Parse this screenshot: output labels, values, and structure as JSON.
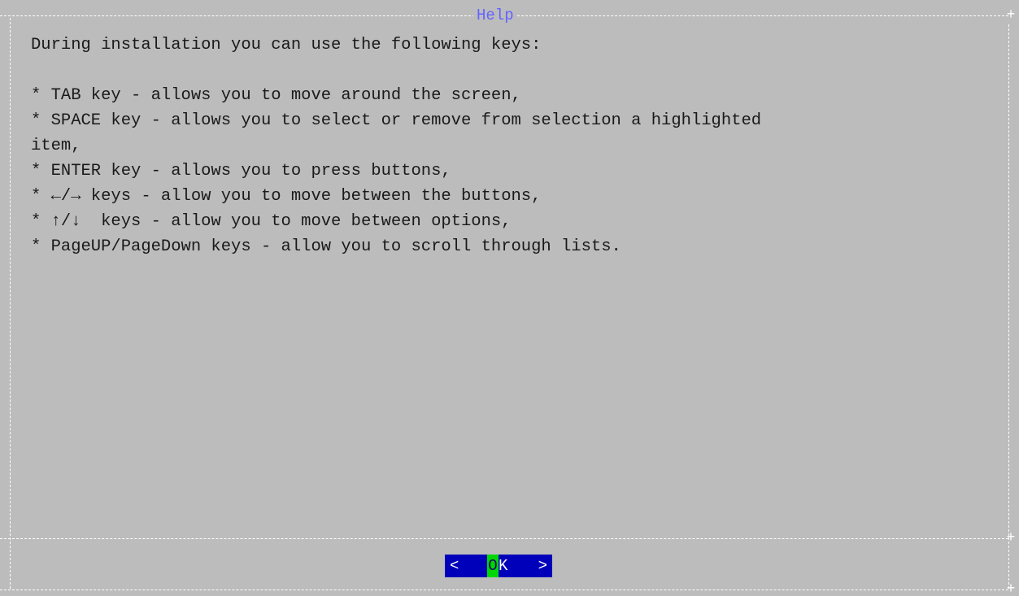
{
  "dialog": {
    "title": "Help"
  },
  "content": {
    "lines": [
      "During installation you can use the following keys:",
      "",
      "* TAB key - allows you to move around the screen,",
      "* SPACE key - allows you to select or remove from selection a highlighted",
      "item,",
      "* ENTER key - allows you to press buttons,",
      "* ←/→ keys - allow you to move between the buttons,",
      "* ↑/↓  keys - allow you to move between options,",
      "* PageUP/PageDown keys - allow you to scroll through lists."
    ]
  },
  "buttons": {
    "ok": {
      "left_bracket": "<",
      "hotkey": "O",
      "rest": "K",
      "right_bracket": ">"
    }
  },
  "colors": {
    "background": "#bcbcbc",
    "title": "#6464ff",
    "button_bg": "#0000bb",
    "hotkey_bg": "#00d700"
  }
}
